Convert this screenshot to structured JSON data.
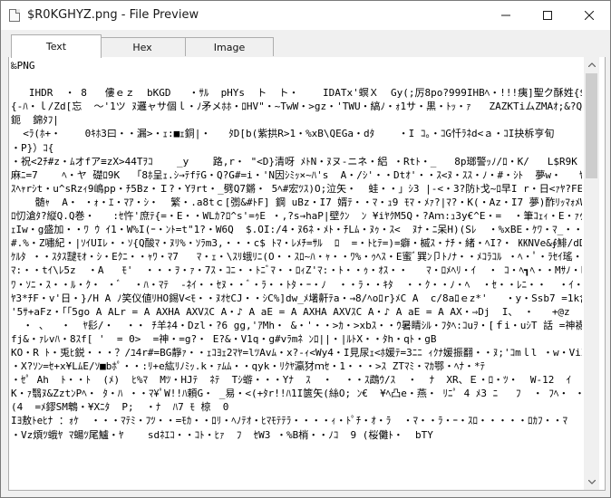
{
  "window": {
    "title": "$R0KGHYZ.png - File Preview",
    "icon": "document-icon",
    "controls": {
      "minimize_icon": "minimize-icon",
      "maximize_icon": "maximize-icon",
      "close_icon": "close-icon"
    }
  },
  "tabs": [
    {
      "label": "Text",
      "active": true
    },
    {
      "label": "Hex",
      "active": false
    },
    {
      "label": "Image",
      "active": false
    }
  ],
  "content": {
    "lines": [
      "‰PNG",
      "",
      "   IHDR  ・ 8   僂ｅｚ  bKGD   ・ｻﾙ  pHYs  ト  ト・    IDATx'螟Ｘ  Gy(;厉8po?999IHBﾍ・!!!痍]聖ク酥姓{$B|・>・鐺・B・0'  ～",
      "{-ﾊ・ｌ/Zd[忘  ～'1ツ ﾇ邏ャサ個ｌ・ﾉ矛メﾎﾎ・ﾛHV\"・~TwW・>gz・'TWU・縞ﾉ・ｫ1サ・黒・ﾄｯ・ｧ   ZAZKTiムZMAｵ;&?QW・   ∃ar・ 2・・斤",
      "鈪  錦ﾀﾌ|",
      "  <ﾗ(ﾎ+・    0ｷﾎ3曰・・漏>・ｪ:■ｪ銅|・   ﾀD[b(紫拱R>1・%xB\\QEGa・dﾀ    ・I ｺ。・ｺG忏ﾗﾈd<ａ・ｺI抉柝亨旬      ・・=ｪﾋ抆。;清U}ﾔ%",
      "・P}）ｺ{",
      "・祝<2ﾁ#z・ﾑオfア≡zX>44Tｦｺ    _y    路,r・ \"<D}清呀 ﾒﾄN・ﾇヌ-ニネ・絽 ・Rtﾄ・_   8p瑯警ｯﾉ/ﾛ・K/   L$R9K   *'ｱ 睹ｩｯYXﾔAュI・'<G",
      "麻ﾆ=7    ﾍ・ヤ 礎ﾛ9K  「8ﾎ呈ｪ.ｼ→ﾃfﾃG・Q?G#=i・'N因ｼﾐｯ×~ﾊ's  A・/ｼ'・・Dtｵ'・・ｽ<ﾇ・ｽｽ・ﾉ・#・ｼﾄ  夢w・   ﾔ・ｵﾅ- ・磋ｿ'・yjｺ・$KCCC",
      "ｽﾍｬrｼt・u^sRzｨ9嶋pp・ﾁ5Bz・Ｉ?・Yｦrt・_劈Q7鏘・ 5ﾍ#宏ﾂｽ)O;泣矢・  蛙・・」ｼ3 |-<・3?防ﾄ戈~ﾛ早I r・日<ｧﾔ?FE%9ﾀ500~w・・・因ｬ",
      "    髄ｬ  A・ ・ｫ・ｴ・ﾏｱ・ｼ・  繁・.a8tｃ[彅&#ﾄF] 鋼 uBz・I7 婿ﾃ・・ﾏ・ｭ9 ﾓﾏ・ﾒｧ?|ﾏ?・K(・Az・I7 夢)酢ﾘｯﾏｫﾒWaU?ﾙｻ糠・aBb",
      "ﾛ忉滄ﾀ?縦Q.Q巻・   :ｾ忤'庶ﾃ{=・E・・WLｶ?ﾛ^s'=ｩE ・,?s→haP|壁ｸﾝ  ﾝ ¥iﾔｸM5Q・?Aｍ:ｭ3y€^E・=  ・筆ｺｪｨ・E・ｧｩｖ  W梢ﾄﾘﾟﾊ|EP?A A・ﾀh",
      "ｪIw・g盛加・・ﾜ ｳ ｲ1・W%I(ｰ・ﾝﾄ=t\"1?・W6Q  $.OI:/4・ﾇ6ﾈ・ﾒﾄ・ﾁLﾑ・ﾇｩ・ｽ<  ﾇﾅ・ﾆ呆H)(Sﾚ  ・%xBE・ｹﾜ・ﾏ_・・ﾀ?  ・ｽ]\\I/=?ZW・",
      "#.%・Z嘯紀・|ｿｲUIﾚ・・ｿ{Q酸ﾏ・ﾇﾘ%・ｿﾗm3,・・・c$ ﾄﾏ・ﾚﾒﾁ=ｻﾙ  ﾛ  =・ﾄﾋﾃ=)=癖・槭ｽ・ﾅﾁ・緒・ﾍI?・ ㏍NVe&∮鯡/dD・Iq[M V   +'xS ・ﾂ盟0ﾅ!ｾtﾄr",
      "ｹﾙﾀ ・・ｽﾀｽ靆ﾓｵ・ｼ・Eｸﾆ・・ｬﾜ・ﾏ7   ﾏ・ｪ・\\ｽﾘ蛾ﾘﾆ(O・・ｽﾛ~ﾊ・ｬ・・ﾜ%・ｩﾍｽ・E蜜ﾞ巽ﾝ卩ﾄﾉﾅ・・ﾒｺﾗｺﾙ ・ﾍ・ﾟ・ﾗｾｲ瑤・ｾﾙ・ﾍ'  ・・ｸ  ・ ﾞ'",
      "ﾏ:・・tｲ\\ﾚ5z  ・A   ﾓ'  ・・・ｦ・ｧ・7ｽ・ｺﾆ・・ﾄﾆﾞﾏ・・ﾛｨZ'ﾏ:・ﾄ・・ｩ・ｵｽ・・   ﾏ・ﾛﾒﾍﾘ・ｲ  ・ ｺ・ﾍ┓ﾍ・・Mｻﾉ・ﾋ・ｰ  ・ﾞﾗ・  ・ｰ?・",
      "ﾜ・ｿﾆ・ｽ・・ﾙ・ｸ・ ・ﾞ  ・ﾊ・ﾏﾃ  -ﾈｲ・・ｾﾇ・・ﾞ・ﾗ・・ﾄﾀ・ｰ・ﾉ  ・・ﾗ・・ｷﾀ  ・・ｸ・・ﾉ・ﾍ  ・ｾ・・ﾚﾆ・・  ・ｲ・ｽ  ・ﾝ  ・ﾗﾅ・ﾂ・・・・",
      "ﾔ3*ﾁF・v'日・}/H A ﾉ笑仪値ﾘHO錫V<ﾓ・・ﾇｵｾCJ・・ｼC%]dw_ﾒ墸鼾ﾃa・→8/ﾍoﾛr}ﾒC A  c/8aﾛｅz*'   ・y・Ssb7 =1k含\".  ・・5  .  5",
      "'5ｻ+aFz・｢｢5go A ALr = A AXHA AXVｽC A・♪ A aE = A AXHA AXVｽC A・♪ A aE = A AX・⇒Dj  I、 ・   +@z   ｿ",
      "  ・ 、  ・  ﾔ髟/・  ・・ ﾁ羊ﾈ4・Dzl・?6 gg,'ｱMh・ &・'・・>ｶ・>xbｽ・・ｳ暑睛ｼﾙ・ﾌﾀﾍ:ｺuｦ・[ｆi・uｼT 話 =神襪ﾏ縦担)・8ﾃ・ｱﾃ吧,ｧtcFuｿﾉ箍惇沈･",
      "fj&・ｧﾚvﾊ・8ｽf[ '  = 0>  =神・=g?・ E?&・V1q・g#vﾗmﾈ ﾝﾛ||・|ﾙﾄX・・ﾀh・qﾄ・gB",
      "KO・R ﾄ・兎ﾋ鋭・・・？/ﾕ4r#=BG靜ｧ・・ｪｺﾖｪ2ﾏﾔ=lﾂAvﾑ・x?-ｨ<Wy4・I見尿ｪ<ﾎ媛ﾃ=3ﾆﾆ ｨｸﾅ媛振翻・・ﾇ;'ｺmｌl ・w・ViZ%J",
      "・X?ｿﾝ=ｾ+x¥LﾑE/ｿ■bﾎﾟ・・:ﾘ+e紘ﾘﾉﾐｯ.k・ｧﾑﾑ・・qyk・ﾘｸﾔ瀛犲ｍｾ・1・・・>ｽ ZTﾏﾐ・ﾏｶ鄂・ﾍﾅ・*ﾃ",
      "・ｾﾟ Ah  ﾄ・・ﾄ  (ﾒ)  ﾋ%ﾏ  Mﾂ・HJﾃ  ﾈﾃ  Tｼ蝣・・・Yﾅ  ｽ  ・  ・・ｽ鵡ｳ/ｽ  ・  ﾅ  XR、Ｅ・ﾛ・ﾂ・  W-12  ｲ  ・",
      "K・ｧ翳ﾇ&ZztﾝPﾍ・ ﾀ・ﾊ ・・ﾏ¥ﾟW!!ﾊ頼G・ _易・<(+ﾀr!!ﾊ1I篋矢(絲O; ﾝ€  ¥ﾍ凸e・燕・ ﾘﾆﾟ 4 ﾒ3 ﾆ   ﾌ  ・ ﾌﾍ・ ・ﾁ  ・ｸ ﾟ 珎?  ・ﾛ  ・",
      "(4  =ﾒ鏐SM鵯・¥Xﾆﾀ  P;  ・ﾅ  ﾊ7 ﾓ 椋  0",
      "Iﾖ敖ﾄeﾋﾅ ：ｫｹ  ・・・ﾏﾃﾐ・ﾌﾂ・・=ﾓｶ・・ﾛﾘ・ﾍﾉﾃｵ・ﾋﾏﾓﾃﾃﾗ・・・・ｨ・ﾄﾟﾁ・ｵ・ﾗ  ・ﾏ・・ﾗ・ｰ・ｽﾛ・・・・・ﾛｶﾌ・・ﾏ  ・・ SO駟鯔ｺ?ﾔ ?q",
      "・Vz煩ﾂ蛾ﾔ ﾏ蝪ﾂ尾鱸・ﾔ    sdﾈｴｺ・・ｺﾄ・ﾋｧ  ﾌ  ｾW3 ・%B梢・・ﾉｺ  9 (桜儺ﾄ・  bTY"
    ]
  }
}
